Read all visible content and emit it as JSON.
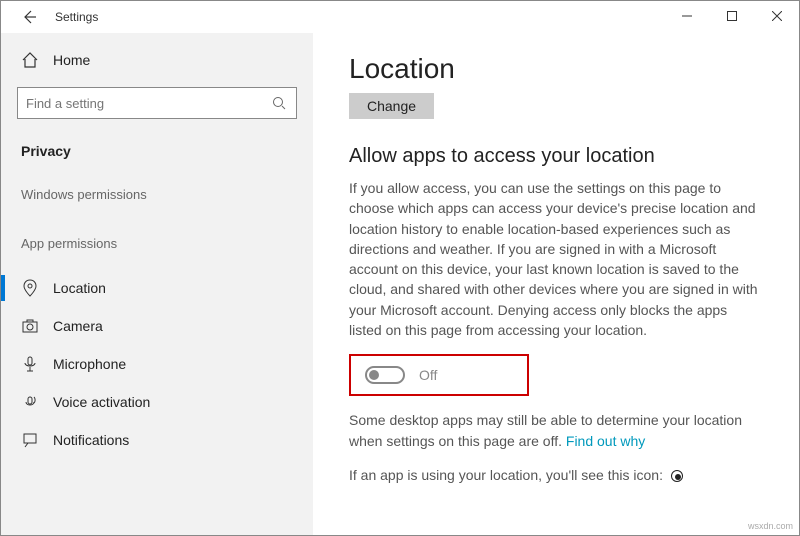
{
  "titlebar": {
    "title": "Settings"
  },
  "sidebar": {
    "home": "Home",
    "search_placeholder": "Find a setting",
    "category": "Privacy",
    "group1": "Windows permissions",
    "group2": "App permissions",
    "items": [
      {
        "label": "Location",
        "active": true
      },
      {
        "label": "Camera"
      },
      {
        "label": "Microphone"
      },
      {
        "label": "Voice activation"
      },
      {
        "label": "Notifications"
      }
    ]
  },
  "main": {
    "title": "Location",
    "change": "Change",
    "subhead": "Allow apps to access your location",
    "desc": "If you allow access, you can use the settings on this page to choose which apps can access your device's precise location and location history to enable location-based experiences such as directions and weather. If you are signed in with a Microsoft account on this device, your last known location is saved to the cloud, and shared with other devices where you are signed in with your Microsoft account. Denying access only blocks the apps listed on this page from accessing your location.",
    "toggle_label": "Off",
    "desktop_note_pre": "Some desktop apps may still be able to determine your location when settings on this page are off. ",
    "desktop_note_link": "Find out why",
    "icon_note": "If an app is using your location, you'll see this icon:"
  },
  "watermark": "wsxdn.com"
}
